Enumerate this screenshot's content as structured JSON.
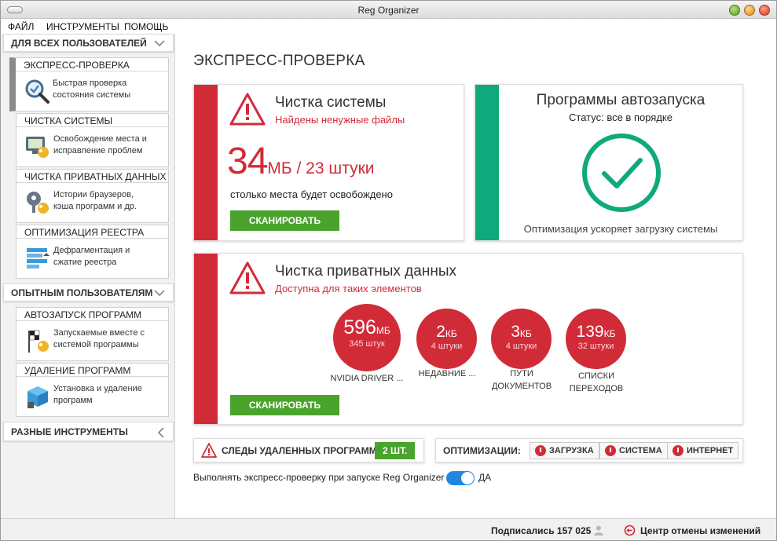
{
  "window": {
    "title": "Reg Organizer"
  },
  "menu": {
    "file": "ФАЙЛ",
    "tools": "ИНСТРУМЕНТЫ",
    "help": "ПОМОЩЬ"
  },
  "sidebar": {
    "all_users_header": "ДЛЯ ВСЕХ ПОЛЬЗОВАТЕЛЕЙ",
    "advanced_header": "ОПЫТНЫМ ПОЛЬЗОВАТЕЛЯМ",
    "misc_header": "РАЗНЫЕ ИНСТРУМЕНТЫ",
    "items": [
      {
        "title": "ЭКСПРЕСС-ПРОВЕРКА",
        "desc1": "Быстрая проверка",
        "desc2": "состояния системы"
      },
      {
        "title": "ЧИСТКА СИСТЕМЫ",
        "desc1": "Освобождение места и",
        "desc2": "исправление проблем"
      },
      {
        "title": "ЧИСТКА ПРИВАТНЫХ ДАННЫХ",
        "desc1": "Истории браузеров,",
        "desc2": "кэша программ и др."
      },
      {
        "title": "ОПТИМИЗАЦИЯ РЕЕСТРА",
        "desc1": "Дефрагментация и",
        "desc2": "сжатие реестра"
      },
      {
        "title": "АВТОЗАПУСК ПРОГРАММ",
        "desc1": "Запускаемые вместе с",
        "desc2": "системой программы"
      },
      {
        "title": "УДАЛЕНИЕ ПРОГРАММ",
        "desc1": "Установка и удаление",
        "desc2": "программ"
      }
    ]
  },
  "main": {
    "title": "ЭКСПРЕСС-ПРОВЕРКА",
    "system_clean": {
      "title": "Чистка системы",
      "subtitle": "Найдены ненужные файлы",
      "size_value": "34",
      "size_unit": "МБ / 23 штуки",
      "note": "столько места будет освобождено",
      "button": "СКАНИРОВАТЬ"
    },
    "autorun": {
      "title": "Программы автозапуска",
      "status": "Статус: все в порядке",
      "note": "Оптимизация ускоряет загрузку системы"
    },
    "private": {
      "title": "Чистка приватных данных",
      "subtitle": "Доступна для таких элементов",
      "button": "СКАНИРОВАТЬ",
      "items": [
        {
          "value": "596",
          "unit": "МБ",
          "count": "345 штук",
          "label1": "NVIDIA DRIVER ...",
          "label2": ""
        },
        {
          "value": "2",
          "unit": "КБ",
          "count": "4 штуки",
          "label1": "НЕДАВНИЕ ...",
          "label2": ""
        },
        {
          "value": "3",
          "unit": "КБ",
          "count": "4 штуки",
          "label1": "ПУТИ",
          "label2": "ДОКУМЕНТОВ"
        },
        {
          "value": "139",
          "unit": "КБ",
          "count": "32 штуки",
          "label1": "СПИСКИ",
          "label2": "ПЕРЕХОДОВ"
        }
      ]
    },
    "traces": {
      "label": "СЛЕДЫ УДАЛЕННЫХ ПРОГРАММ",
      "count": "2 ШТ."
    },
    "optimizations": {
      "label": "ОПТИМИЗАЦИИ:",
      "boot": "ЗАГРУЗКА",
      "system": "СИСТЕМА",
      "internet": "ИНТЕРНЕТ"
    },
    "run_on_start": {
      "label": "Выполнять экспресс-проверку при запуске Reg Organizer",
      "state": "ДА"
    }
  },
  "status": {
    "subscribed": "Подписались 157 025",
    "undo_center": "Центр отмены изменений"
  },
  "colors": {
    "accent_red": "#d22b38",
    "accent_green": "#0fa97b",
    "button_green": "#4aa32c",
    "toggle_blue": "#1e88e0"
  }
}
